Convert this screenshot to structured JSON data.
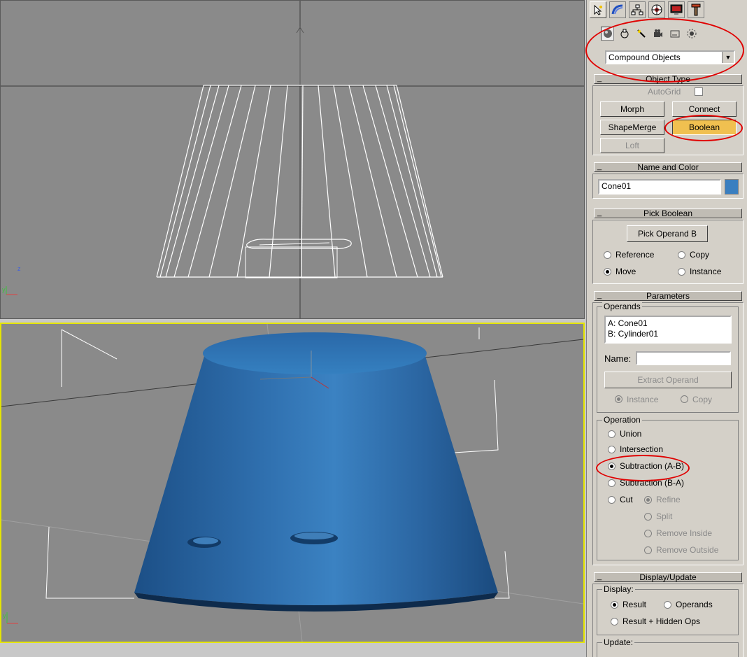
{
  "command_panel": {
    "tabs": [
      {
        "icon": "create-icon"
      },
      {
        "icon": "modify-icon"
      },
      {
        "icon": "hierarchy-icon"
      },
      {
        "icon": "motion-icon"
      },
      {
        "icon": "display-icon"
      },
      {
        "icon": "utilities-icon"
      }
    ],
    "create_categories": [
      {
        "icon": "geometry-icon"
      },
      {
        "icon": "shapes-icon"
      },
      {
        "icon": "lights-icon"
      },
      {
        "icon": "cameras-icon"
      },
      {
        "icon": "helpers-icon"
      },
      {
        "icon": "space-warps-icon"
      }
    ],
    "subcategory": "Compound Objects"
  },
  "object_type": {
    "title": "Object Type",
    "autogrid_label": "AutoGrid",
    "buttons": {
      "morph": "Morph",
      "connect": "Connect",
      "shapemerge": "ShapeMerge",
      "boolean": "Boolean",
      "loft": "Loft"
    }
  },
  "name_and_color": {
    "title": "Name and Color",
    "name_value": "Cone01",
    "color": "#3a7fc0"
  },
  "pick_boolean": {
    "title": "Pick Boolean",
    "pick_button": "Pick Operand B",
    "options": {
      "reference": "Reference",
      "copy": "Copy",
      "move": "Move",
      "instance": "Instance"
    },
    "selected": "Move"
  },
  "parameters": {
    "title": "Parameters",
    "operands_label": "Operands",
    "operands": [
      "A: Cone01",
      "B: Cylinder01"
    ],
    "name_label": "Name:",
    "name_value": "",
    "extract_button": "Extract Operand",
    "extract_instance": "Instance",
    "extract_copy": "Copy",
    "operation_label": "Operation",
    "operations": {
      "union": "Union",
      "intersection": "Intersection",
      "subtraction_ab": "Subtraction (A-B)",
      "subtraction_ba": "Subtraction (B-A)",
      "cut": "Cut"
    },
    "selected_operation": "Subtraction (A-B)",
    "cut_options": {
      "refine": "Refine",
      "split": "Split",
      "remove_inside": "Remove Inside",
      "remove_outside": "Remove Outside"
    }
  },
  "display_update": {
    "title": "Display/Update",
    "display_label": "Display:",
    "result": "Result",
    "operands": "Operands",
    "result_hidden": "Result + Hidden Ops",
    "selected": "Result",
    "update_label": "Update:"
  },
  "colors": {
    "viewport_bg": "#8a8a8a",
    "active_viewport_border": "#e5e500",
    "pressed_button": "#f0c050",
    "annotation": "#e00000",
    "cone_blue": "#2e6aa8"
  }
}
